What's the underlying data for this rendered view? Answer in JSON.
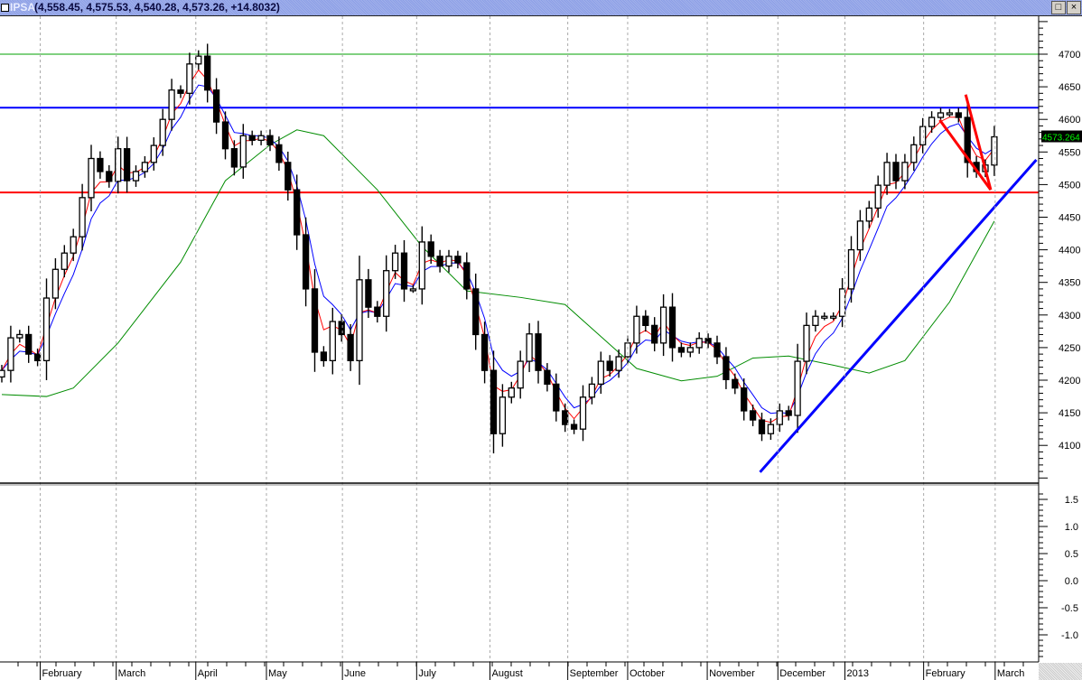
{
  "window": {
    "symbol": "IPSA",
    "readout": "(4,558.45, 4,575.53, 4,540.28, 4,573.26, +14.8032)",
    "restore_label": "□",
    "close_label": "×"
  },
  "chart_data": {
    "type": "candlestick",
    "title": "IPSA",
    "last_price_label": "4573.264",
    "close": [
      4215,
      4265,
      4270,
      4240,
      4230,
      4326,
      4370,
      4395,
      4420,
      4480,
      4540,
      4520,
      4505,
      4555,
      4506,
      4520,
      4534,
      4560,
      4600,
      4645,
      4640,
      4685,
      4697,
      4645,
      4596,
      4555,
      4527,
      4575,
      4568,
      4575,
      4561,
      4534,
      4492,
      4423,
      4340,
      4243,
      4230,
      4290,
      4270,
      4230,
      4354,
      4312,
      4298,
      4368,
      4395,
      4340,
      4340,
      4412,
      4390,
      4375,
      4390,
      4380,
      4340,
      4270,
      4215,
      4118,
      4174,
      4188,
      4229,
      4271,
      4215,
      4194,
      4153,
      4132,
      4125,
      4174,
      4194,
      4229,
      4215,
      4236,
      4257,
      4298,
      4284,
      4257,
      4312,
      4250,
      4243,
      4250,
      4264,
      4257,
      4236,
      4201,
      4188,
      4153,
      4139,
      4118,
      4132,
      4153,
      4146,
      4229,
      4284,
      4298,
      4298,
      4298,
      4340,
      4400,
      4444,
      4464,
      4499,
      4534,
      4506,
      4534,
      4561,
      4589,
      4603,
      4610,
      4610,
      4603,
      4534,
      4520,
      4530,
      4573.26
    ],
    "ma_fast_period": 3,
    "ma_mid_period": 5,
    "ma_long": [
      [
        0,
        4178
      ],
      [
        5,
        4175
      ],
      [
        8,
        4188
      ],
      [
        13,
        4257
      ],
      [
        20,
        4381
      ],
      [
        25,
        4506
      ],
      [
        30,
        4561
      ],
      [
        33,
        4584
      ],
      [
        36,
        4575
      ],
      [
        42,
        4492
      ],
      [
        47,
        4405
      ],
      [
        52,
        4337
      ],
      [
        58,
        4327
      ],
      [
        63,
        4316
      ],
      [
        71,
        4218
      ],
      [
        76,
        4199
      ],
      [
        80,
        4206
      ],
      [
        84,
        4234
      ],
      [
        88,
        4237
      ],
      [
        93,
        4223
      ],
      [
        97,
        4211
      ],
      [
        101,
        4230
      ],
      [
        106,
        4320
      ],
      [
        111,
        4444
      ]
    ],
    "horizontal_lines": [
      {
        "price": 4700,
        "color": "#00a000"
      },
      {
        "price": 4618,
        "color": "#0000ff"
      },
      {
        "price": 4488,
        "color": "#ff0000"
      }
    ],
    "trendlines": [
      {
        "from": [
          84.8,
          4059
        ],
        "to": [
          115.7,
          4538
        ],
        "color": "#0000ff"
      },
      {
        "from": [
          104.9,
          4599
        ],
        "to": [
          110.6,
          4492
        ],
        "color": "#ff0000"
      },
      {
        "from": [
          107.8,
          4638
        ],
        "to": [
          110.6,
          4492
        ],
        "color": "#ff0000"
      }
    ],
    "ylim": [
      4050,
      4760
    ],
    "yticks": [
      4700,
      4650,
      4600,
      4550,
      4500,
      4450,
      4400,
      4350,
      4300,
      4250,
      4200,
      4150,
      4100
    ],
    "lower_panel": {
      "ylim": [
        -1.5,
        1.7
      ],
      "yticks": [
        "1.5",
        "1.0",
        "0.5",
        "0.0",
        "-0.5",
        "-1.0"
      ],
      "ytick_values": [
        1.5,
        1.0,
        0.5,
        0.0,
        -0.5,
        -1.0
      ]
    },
    "months": [
      {
        "label": "February",
        "bar": 4.7
      },
      {
        "label": "March",
        "bar": 13.2
      },
      {
        "label": "April",
        "bar": 22.1
      },
      {
        "label": "May",
        "bar": 30.0
      },
      {
        "label": "June",
        "bar": 38.5
      },
      {
        "label": "July",
        "bar": 46.8
      },
      {
        "label": "August",
        "bar": 55.0
      },
      {
        "label": "September",
        "bar": 63.7
      },
      {
        "label": "October",
        "bar": 70.4
      },
      {
        "label": "November",
        "bar": 79.3
      },
      {
        "label": "December",
        "bar": 87.2
      },
      {
        "label": "2013",
        "bar": 94.7
      },
      {
        "label": "February",
        "bar": 103.5
      },
      {
        "label": "March",
        "bar": 111.5
      }
    ],
    "colors": {
      "fast": "#ff0000",
      "mid": "#0000ff",
      "long": "#008c00",
      "last_bg": "#000000",
      "last_fg": "#00ff00"
    }
  }
}
